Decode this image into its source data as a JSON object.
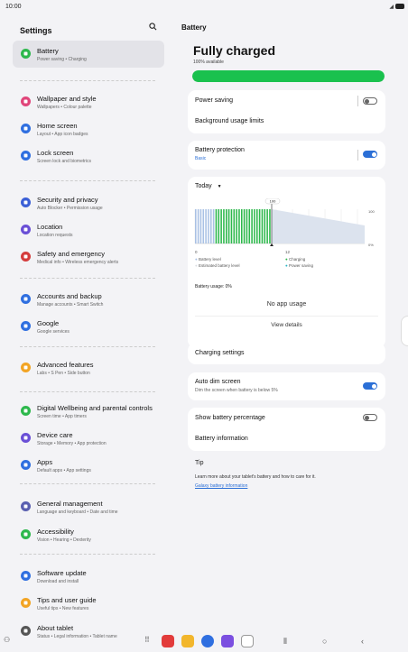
{
  "status_bar": {
    "time": "10:00"
  },
  "left": {
    "title": "Settings",
    "items": [
      {
        "label": "Battery",
        "sub": "Power saving • Charging",
        "icon": "battery-icon",
        "color": "#2db84c"
      },
      {
        "label": "Wallpaper and style",
        "sub": "Wallpapers • Colour palette",
        "icon": "palette-icon",
        "color": "#e0457a"
      },
      {
        "label": "Home screen",
        "sub": "Layout • App icon badges",
        "icon": "home-icon",
        "color": "#2f6fe0"
      },
      {
        "label": "Lock screen",
        "sub": "Screen lock and biometrics",
        "icon": "lock-icon",
        "color": "#2f6fe0"
      },
      {
        "label": "Security and privacy",
        "sub": "Auto Blocker • Permission usage",
        "icon": "shield-icon",
        "color": "#3b5fd6"
      },
      {
        "label": "Location",
        "sub": "Location requests",
        "icon": "location-pin-icon",
        "color": "#6a4fd6"
      },
      {
        "label": "Safety and emergency",
        "sub": "Medical info • Wireless emergency alerts",
        "icon": "emergency-icon",
        "color": "#d43c3c"
      },
      {
        "label": "Accounts and backup",
        "sub": "Manage accounts • Smart Switch",
        "icon": "sync-icon",
        "color": "#2f6fe0"
      },
      {
        "label": "Google",
        "sub": "Google services",
        "icon": "google-icon",
        "color": "#2f6fe0"
      },
      {
        "label": "Advanced features",
        "sub": "Labs • S Pen • Side button",
        "icon": "star-gear-icon",
        "color": "#f2a424"
      },
      {
        "label": "Digital Wellbeing and parental controls",
        "sub": "Screen time • App timers",
        "icon": "wellbeing-icon",
        "color": "#2db84c"
      },
      {
        "label": "Device care",
        "sub": "Storage • Memory • App protection",
        "icon": "device-care-icon",
        "color": "#6a4fd6"
      },
      {
        "label": "Apps",
        "sub": "Default apps • App settings",
        "icon": "apps-grid-icon",
        "color": "#2f6fe0"
      },
      {
        "label": "General management",
        "sub": "Language and keyboard • Date and time",
        "icon": "sliders-icon",
        "color": "#5a5fb0"
      },
      {
        "label": "Accessibility",
        "sub": "Vision • Hearing • Dexterity",
        "icon": "accessibility-icon",
        "color": "#2db84c"
      },
      {
        "label": "Software update",
        "sub": "Download and install",
        "icon": "update-icon",
        "color": "#2f6fe0"
      },
      {
        "label": "Tips and user guide",
        "sub": "Useful tips • New features",
        "icon": "bulb-icon",
        "color": "#f2a424"
      },
      {
        "label": "About tablet",
        "sub": "Status • Legal information • Tablet name",
        "icon": "info-icon",
        "color": "#555"
      }
    ]
  },
  "right": {
    "title": "Battery",
    "headline": "Fully charged",
    "available": "100% available",
    "level": 1.0,
    "power_saving": {
      "label": "Power saving",
      "on": false
    },
    "background_limits": "Background usage limits",
    "battery_protection": {
      "label": "Battery protection",
      "sub": "Basic",
      "on": true
    },
    "graph": {
      "period": "Today",
      "marker": "100",
      "y_max_label": "100",
      "y_min_label": "0%",
      "x_labels": [
        "0",
        "12"
      ],
      "legend": [
        "Battery level",
        "Charging",
        "Estimated battery level",
        "Power saving"
      ],
      "usage": "Battery usage: 0%",
      "no_usage": "No app usage",
      "view_details": "View details"
    },
    "charging_settings": "Charging settings",
    "auto_dim": {
      "label": "Auto dim screen",
      "sub": "Dim the screen when battery is below 5%",
      "on": true
    },
    "show_percentage": {
      "label": "Show battery percentage",
      "on": false
    },
    "battery_info": "Battery information",
    "tip": {
      "title": "Tip",
      "text": "Learn more about your tablet's battery and how to care for it.",
      "link": "Galaxy battery information"
    }
  }
}
